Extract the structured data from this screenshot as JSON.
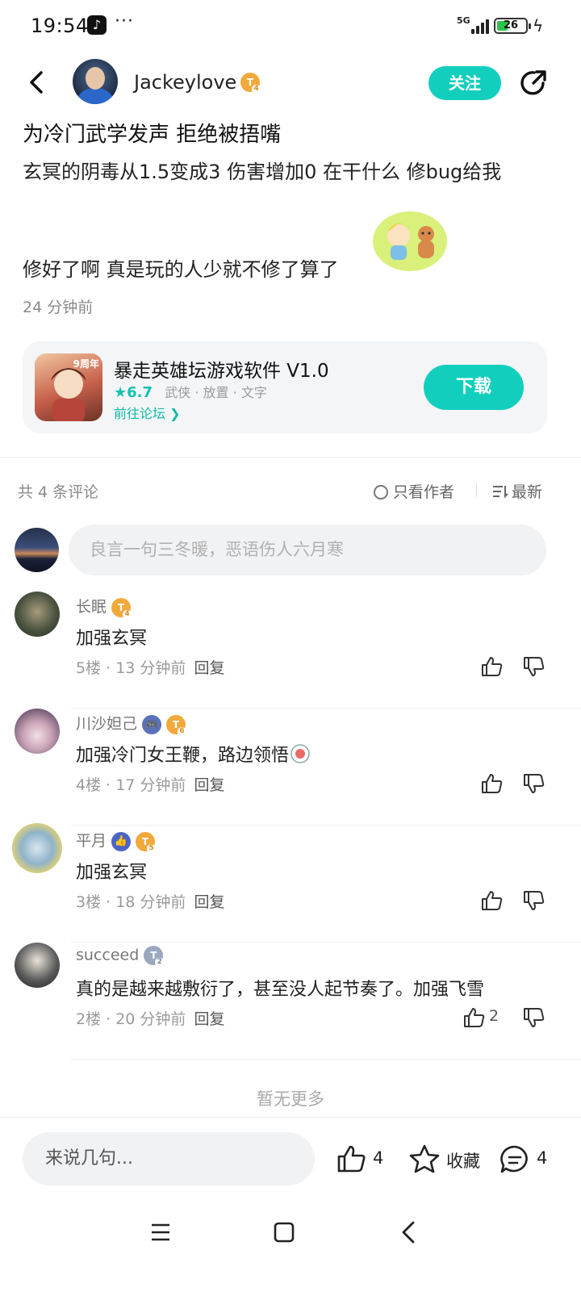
{
  "status_bar": {
    "time": "19:54",
    "app_icon": "tiktok-icon",
    "dots": "···",
    "network": "5G",
    "battery_level": "26"
  },
  "header": {
    "author": "Jackeylove",
    "author_level_badge": "T",
    "author_level_num": "4",
    "follow_label": "关注",
    "icons": {
      "back": "back-chevron-icon",
      "share": "share-icon"
    }
  },
  "post": {
    "title": "为冷门武学发声 拒绝被捂嘴",
    "body_line1": "玄冥的阴毒从1.5变成3 伤害增加0 在干什么 修bug给我",
    "body_line2": "修好了啊 真是玩的人少就不修了算了",
    "time": "24 分钟前"
  },
  "game_card": {
    "name": "暴走英雄坛游戏软件 V1.0",
    "anniversary": "9周年",
    "score": "★6.7",
    "tags": "武侠 · 放置 · 文字",
    "forum_link": "前往论坛 ❯",
    "download_label": "下载"
  },
  "comments_header": {
    "count_text": "共 4 条评论",
    "only_author": "只看作者",
    "sort_label": "最新"
  },
  "comment_input": {
    "placeholder": "良言一句三冬暖，恶语伤人六月寒"
  },
  "comments": [
    {
      "name": "长眠",
      "badge": "T",
      "level": "4",
      "text": "加强玄冥",
      "meta": "5楼 · 13 分钟前",
      "reply": "回复",
      "likes": ""
    },
    {
      "name": "川沙妲己",
      "badge": "T",
      "level": "6",
      "game_badge": "🎮",
      "text": "加强冷门女王鞭，路边领悟",
      "meta": "4楼 · 17 分钟前",
      "reply": "回复",
      "likes": ""
    },
    {
      "name": "平月",
      "badge": "T",
      "level": "5",
      "like_badge": "👍",
      "text": "加强玄冥",
      "meta": "3楼 · 18 分钟前",
      "reply": "回复",
      "likes": ""
    },
    {
      "name": "succeed",
      "badge": "T",
      "level": "2",
      "text": "真的是越来越敷衍了，甚至没人起节奏了。加强飞雪",
      "meta": "2楼 · 20 分钟前",
      "reply": "回复",
      "likes": "2"
    }
  ],
  "no_more": "暂无更多",
  "bottom_bar": {
    "say_placeholder": "来说几句...",
    "like_count": "4",
    "fav_label": "收藏",
    "comment_count": "4"
  },
  "colors": {
    "accent": "#12cfbd",
    "badge_gold": "#f2a93b",
    "muted_text": "#9a9a9a"
  }
}
